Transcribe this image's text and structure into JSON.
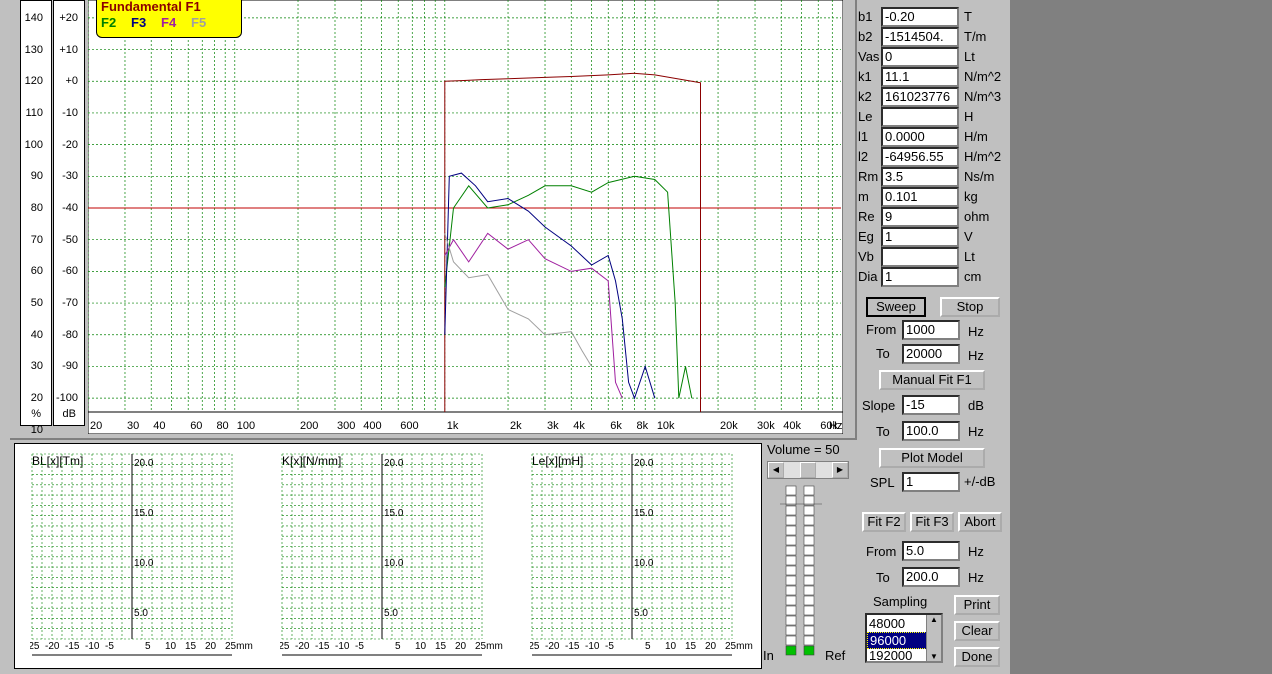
{
  "chart_data": {
    "type": "line",
    "title": "",
    "xlabel": "Hz",
    "ylabel": "dB",
    "x_scale": "log",
    "x_ticks": [
      "20",
      "30",
      "40",
      "60",
      "80",
      "100",
      "200",
      "300",
      "400",
      "600",
      "1k",
      "2k",
      "3k",
      "4k",
      "6k",
      "8k",
      "10k",
      "20k",
      "30k",
      "40k",
      "60k",
      "Hz"
    ],
    "left_axis_label": "%",
    "left_ticks": [
      "140",
      "130",
      "120",
      "110",
      "100",
      "90",
      "80",
      "70",
      "60",
      "50",
      "40",
      "30",
      "20",
      "10"
    ],
    "db_axis_label": "dB",
    "db_ticks": [
      "+20",
      "+10",
      "+0",
      "-10",
      "-20",
      "-30",
      "-40",
      "-50",
      "-60",
      "-70",
      "-80",
      "-90",
      "-100"
    ],
    "reference_line_db": -40,
    "series": [
      {
        "name": "Fundamental F1",
        "color": "#8b0000",
        "x": [
          1000,
          1200,
          1500,
          2000,
          3000,
          4000,
          6000,
          8000,
          10000,
          15000,
          16500
        ],
        "y": [
          0,
          0.2,
          0.5,
          0.8,
          1.2,
          1.5,
          2,
          2.5,
          2,
          0,
          -0.5
        ]
      },
      {
        "name": "F2",
        "color": "#008000",
        "x": [
          1000,
          1100,
          1300,
          1600,
          2000,
          2500,
          3000,
          4000,
          5000,
          6000,
          8000,
          10000,
          11500,
          12500,
          13000,
          14000,
          15000
        ],
        "y": [
          -65,
          -40,
          -33,
          -40,
          -39,
          -36,
          -33,
          -33,
          -35,
          -32,
          -30,
          -31,
          -35,
          -70,
          -100,
          -90,
          -100
        ]
      },
      {
        "name": "F3",
        "color": "#000080",
        "x": [
          1000,
          1050,
          1200,
          1400,
          1600,
          2000,
          2500,
          3000,
          4000,
          5000,
          6000,
          6500,
          7000,
          7500,
          8000,
          9000,
          10000
        ],
        "y": [
          -80,
          -30,
          -29,
          -33,
          -38,
          -37,
          -41,
          -46,
          -52,
          -58,
          -55,
          -63,
          -75,
          -95,
          -100,
          -90,
          -100
        ]
      },
      {
        "name": "F4",
        "color": "#a020a0",
        "x": [
          1000,
          1100,
          1300,
          1600,
          2000,
          2500,
          3000,
          4000,
          5000,
          6000,
          6500,
          7000
        ],
        "y": [
          -55,
          -50,
          -57,
          -48,
          -53,
          -50,
          -56,
          -60,
          -59,
          -63,
          -95,
          -100
        ]
      },
      {
        "name": "F5",
        "color": "#a0a0a0",
        "x": [
          1000,
          1100,
          1300,
          1600,
          2000,
          2500,
          3000,
          4000,
          4500,
          5000
        ],
        "y": [
          -48,
          -57,
          -62,
          -61,
          -72,
          -75,
          -80,
          -79,
          -85,
          -90
        ]
      }
    ]
  },
  "legend": {
    "f1": "Fundamental F1",
    "f2": "F2",
    "f3": "F3",
    "f4": "F4",
    "f5": "F5"
  },
  "params": [
    {
      "name": "b1",
      "value": "-0.20",
      "unit": "T"
    },
    {
      "name": "b2",
      "value": "-1514504.",
      "unit": "T/m"
    },
    {
      "name": "Vas",
      "value": "0",
      "unit": "Lt"
    },
    {
      "name": "k1",
      "value": "11.1",
      "unit": "N/m^2"
    },
    {
      "name": "k2",
      "value": "161023776",
      "unit": "N/m^3"
    },
    {
      "name": "Le",
      "value": "",
      "unit": "H"
    },
    {
      "name": "l1",
      "value": "0.0000",
      "unit": "H/m"
    },
    {
      "name": "l2",
      "value": "-64956.55",
      "unit": "H/m^2"
    },
    {
      "name": "Rm",
      "value": "3.5",
      "unit": "Ns/m"
    },
    {
      "name": "m",
      "value": " 0.101",
      "unit": "kg"
    },
    {
      "name": "Re",
      "value": "9",
      "unit": "ohm"
    },
    {
      "name": "Eg",
      "value": "1",
      "unit": "V"
    },
    {
      "name": "Vb",
      "value": "",
      "unit": "Lt"
    },
    {
      "name": "Dia",
      "value": "1",
      "unit": "cm"
    }
  ],
  "sweep": {
    "sweep": "Sweep",
    "stop": "Stop",
    "from_label": "From",
    "from_value": "1000",
    "to_label": "To",
    "to_value": "20000",
    "unit": "Hz"
  },
  "manual_fit": "Manual Fit F1",
  "slope": {
    "label": "Slope",
    "value": "-15",
    "unit": "dB",
    "to_label": "To",
    "to_value": "100.0",
    "to_unit": "Hz"
  },
  "plot_model": "Plot Model",
  "spl": {
    "label": "SPL",
    "value": "1",
    "unit": "+/-dB"
  },
  "fit": {
    "fit_f2": "Fit F2",
    "fit_f3": "Fit F3",
    "abort": "Abort",
    "from_label": "From",
    "from_value": "5.0",
    "to_label": "To",
    "to_value": "200.0",
    "unit": "Hz"
  },
  "sampling": {
    "label": "Sampling",
    "options": [
      "48000",
      "96000",
      "192000"
    ],
    "selected": "96000"
  },
  "actions": {
    "print": "Print",
    "clear": "Clear",
    "done": "Done"
  },
  "volume": {
    "label": "Volume = 50",
    "value": 50,
    "in": "In",
    "ref": "Ref"
  },
  "mini_charts": [
    {
      "title": "BL[x][Tm]",
      "yticks": [
        "20.0",
        "15.0",
        "10.0",
        "5.0"
      ],
      "xticks": [
        "-25",
        "-20",
        "-15",
        "-10",
        "-5",
        "5",
        "10",
        "15",
        "20",
        "25mm"
      ]
    },
    {
      "title": "K[x][N/mm]",
      "yticks": [
        "20.0",
        "15.0",
        "10.0",
        "5.0"
      ],
      "xticks": [
        "-25",
        "-20",
        "-15",
        "-10",
        "-5",
        "5",
        "10",
        "15",
        "20",
        "25mm"
      ]
    },
    {
      "title": "Le[x][mH]",
      "yticks": [
        "20.0",
        "15.0",
        "10.0",
        "5.0"
      ],
      "xticks": [
        "-25",
        "-20",
        "-15",
        "-10",
        "-5",
        "5",
        "10",
        "15",
        "20",
        "25mm"
      ]
    }
  ]
}
